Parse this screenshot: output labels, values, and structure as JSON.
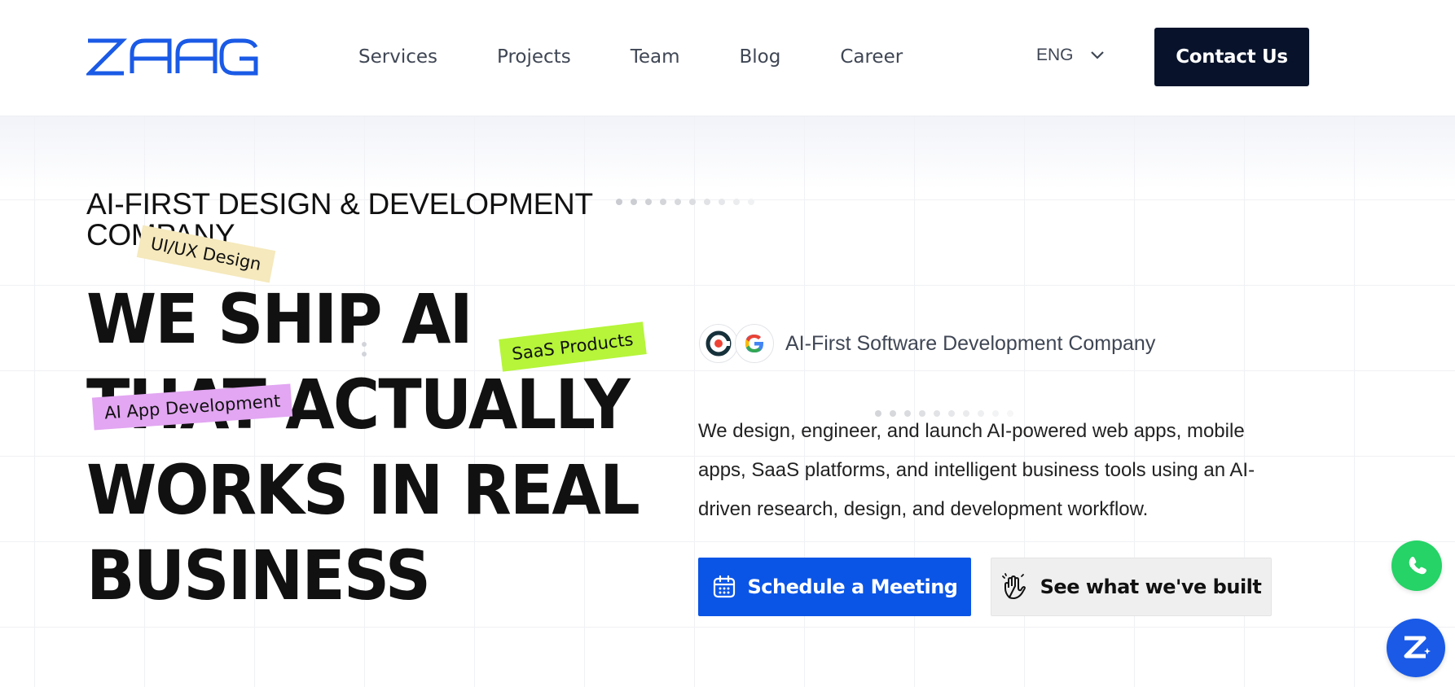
{
  "brand": {
    "logo_text": "ZAAG",
    "color": "#1a5ae6"
  },
  "nav": {
    "items": [
      "Services",
      "Projects",
      "Team",
      "Blog",
      "Career"
    ]
  },
  "language": {
    "selected": "ENG",
    "icon": "chevron-down-icon"
  },
  "header": {
    "contact_label": "Contact Us"
  },
  "hero": {
    "eyebrow": "AI-FIRST DESIGN & DEVELOPMENT COMPANY",
    "headline_lines": [
      "WE SHIP AI",
      "THAT ACTUALLY",
      "WORKS IN REAL",
      "BUSINESS"
    ],
    "tags": {
      "uiux": "UI/UX Design",
      "saas": "SaaS Products",
      "ai_app": "AI App Development"
    },
    "tag_colors": {
      "uiux": "#f5e9bd",
      "saas": "#b6f53a",
      "ai_app": "#e2a6f2"
    },
    "company_badges": [
      "clutch-icon",
      "google-icon"
    ],
    "company_text": "AI-First Software Development Company",
    "description": "We design, engineer, and launch AI-powered web apps, mobile apps, SaaS platforms, and intelligent business tools using an AI-driven research, design, and development workflow.",
    "primary_cta": {
      "label": "Schedule a Meeting",
      "icon": "calendar-icon",
      "color": "#0b55e6"
    },
    "secondary_cta": {
      "label": "See what we've built",
      "icon": "hand-wave-icon"
    }
  },
  "floating": {
    "whatsapp": {
      "icon": "whatsapp-icon",
      "color": "#25d366"
    },
    "chat": {
      "icon": "zaag-chat-icon",
      "color": "#1a5ae6"
    }
  }
}
